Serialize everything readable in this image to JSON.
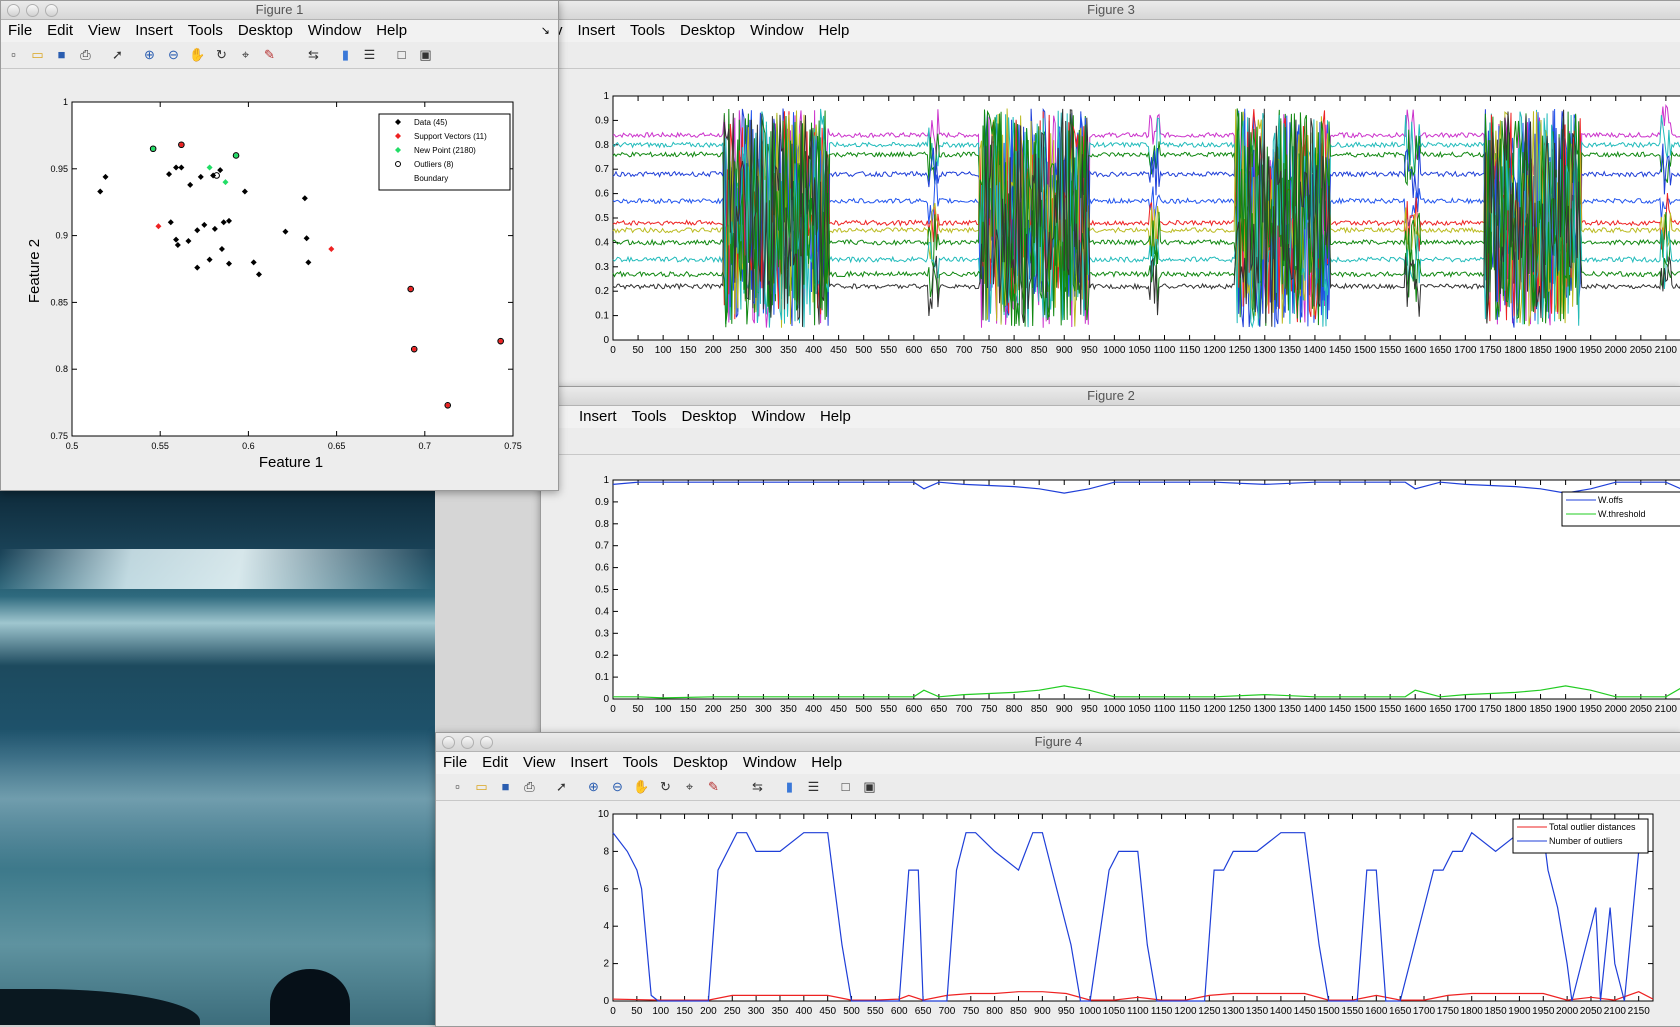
{
  "menu": [
    "File",
    "Edit",
    "View",
    "Insert",
    "Tools",
    "Desktop",
    "Window",
    "Help"
  ],
  "toolbar_icons": [
    "new-file-icon",
    "open-folder-icon",
    "save-icon",
    "print-icon",
    "pointer-icon",
    "zoom-in-icon",
    "zoom-out-icon",
    "pan-hand-icon",
    "rotate-3d-icon",
    "data-cursor-icon",
    "brush-icon",
    "link-plot-icon",
    "colorbar-icon",
    "legend-icon",
    "hide-plot-tools-icon",
    "show-plot-tools-icon"
  ],
  "figure1": {
    "title": "Figure 1",
    "chart_data": {
      "type": "scatter",
      "xlabel": "Feature 1",
      "ylabel": "Feature 2",
      "xlim": [
        0.5,
        0.75
      ],
      "ylim": [
        0.75,
        1
      ],
      "xticks": [
        "0.5",
        "0.55",
        "0.6",
        "0.65",
        "0.7",
        "0.75"
      ],
      "yticks": [
        "0.75",
        "0.8",
        "0.85",
        "0.9",
        "0.95",
        "1"
      ],
      "legend_position": "top-right",
      "legend": [
        "Data (45)",
        "Support Vectors (11)",
        "New Point (2180)",
        "Outliers (8)",
        "Boundary"
      ],
      "data_points": [
        [
          0.516,
          0.933
        ],
        [
          0.519,
          0.944
        ],
        [
          0.555,
          0.946
        ],
        [
          0.559,
          0.951
        ],
        [
          0.562,
          0.951
        ],
        [
          0.567,
          0.938
        ],
        [
          0.573,
          0.944
        ],
        [
          0.584,
          0.949
        ],
        [
          0.58,
          0.945
        ],
        [
          0.598,
          0.933
        ],
        [
          0.632,
          0.928
        ],
        [
          0.556,
          0.91
        ],
        [
          0.559,
          0.897
        ],
        [
          0.56,
          0.893
        ],
        [
          0.566,
          0.896
        ],
        [
          0.571,
          0.904
        ],
        [
          0.575,
          0.908
        ],
        [
          0.581,
          0.905
        ],
        [
          0.586,
          0.91
        ],
        [
          0.589,
          0.911
        ],
        [
          0.578,
          0.882
        ],
        [
          0.585,
          0.89
        ],
        [
          0.589,
          0.879
        ],
        [
          0.571,
          0.876
        ],
        [
          0.603,
          0.88
        ],
        [
          0.606,
          0.871
        ],
        [
          0.621,
          0.903
        ],
        [
          0.633,
          0.898
        ],
        [
          0.634,
          0.88
        ]
      ],
      "support_vectors": [
        [
          0.549,
          0.907
        ],
        [
          0.562,
          0.968
        ],
        [
          0.647,
          0.89
        ],
        [
          0.692,
          0.86
        ],
        [
          0.694,
          0.815
        ],
        [
          0.713,
          0.773
        ],
        [
          0.743,
          0.821
        ]
      ],
      "new_points": [
        [
          0.578,
          0.951
        ],
        [
          0.587,
          0.94
        ],
        [
          0.593,
          0.96
        ],
        [
          0.546,
          0.965
        ]
      ],
      "outliers": [
        [
          0.546,
          0.965
        ],
        [
          0.562,
          0.968
        ],
        [
          0.582,
          0.945
        ],
        [
          0.593,
          0.96
        ],
        [
          0.692,
          0.86
        ],
        [
          0.694,
          0.815
        ],
        [
          0.713,
          0.773
        ],
        [
          0.743,
          0.821
        ]
      ]
    }
  },
  "figure2": {
    "title": "Figure 2",
    "chart_data": {
      "type": "line",
      "xlim": [
        0,
        2180
      ],
      "ylim": [
        0,
        1
      ],
      "xticks": [
        "0",
        "50",
        "100",
        "150",
        "200",
        "250",
        "300",
        "350",
        "400",
        "450",
        "500",
        "550",
        "600",
        "650",
        "700",
        "750",
        "800",
        "850",
        "900",
        "950",
        "1000",
        "1050",
        "1100",
        "1150",
        "1200",
        "1250",
        "1300",
        "1350",
        "1400",
        "1450",
        "1500",
        "1550",
        "1600",
        "1650",
        "1700",
        "1750",
        "1800",
        "1850",
        "1900",
        "1950",
        "2000",
        "2050",
        "2100",
        "2150"
      ],
      "yticks": [
        "0",
        "0.1",
        "0.2",
        "0.3",
        "0.4",
        "0.5",
        "0.6",
        "0.7",
        "0.8",
        "0.9",
        "1"
      ],
      "legend_position": "top-right",
      "series": [
        {
          "name": "W.offs",
          "color": "#1f3fd8",
          "x": [
            0,
            50,
            100,
            200,
            300,
            400,
            550,
            600,
            620,
            650,
            700,
            800,
            850,
            900,
            950,
            1000,
            1100,
            1200,
            1300,
            1400,
            1500,
            1580,
            1600,
            1650,
            1700,
            1800,
            1850,
            1900,
            1950,
            2000,
            2100,
            2130,
            2150
          ],
          "y": [
            0.98,
            0.99,
            0.99,
            0.99,
            0.99,
            0.99,
            0.99,
            0.99,
            0.96,
            0.99,
            0.98,
            0.97,
            0.96,
            0.94,
            0.96,
            0.99,
            0.99,
            0.99,
            0.98,
            0.99,
            0.99,
            0.99,
            0.96,
            0.99,
            0.98,
            0.97,
            0.96,
            0.94,
            0.96,
            0.99,
            0.99,
            0.96,
            0.99
          ]
        },
        {
          "name": "W.threshold",
          "color": "#22cc22",
          "x": [
            0,
            50,
            100,
            200,
            300,
            400,
            550,
            600,
            620,
            650,
            700,
            800,
            850,
            900,
            950,
            1000,
            1100,
            1200,
            1300,
            1400,
            1500,
            1580,
            1600,
            1650,
            1700,
            1800,
            1850,
            1900,
            1950,
            2000,
            2100,
            2130,
            2150
          ],
          "y": [
            0.01,
            0.01,
            0.005,
            0.01,
            0.01,
            0.01,
            0.01,
            0.01,
            0.04,
            0.01,
            0.02,
            0.03,
            0.04,
            0.06,
            0.04,
            0.01,
            0.01,
            0.01,
            0.02,
            0.01,
            0.01,
            0.01,
            0.04,
            0.01,
            0.02,
            0.03,
            0.04,
            0.06,
            0.04,
            0.01,
            0.01,
            0.05,
            0.01
          ]
        }
      ]
    }
  },
  "figure3": {
    "title": "Figure 3",
    "chart_data": {
      "type": "line",
      "xlim": [
        0,
        2180
      ],
      "ylim": [
        0,
        1
      ],
      "xticks": [
        "0",
        "50",
        "100",
        "150",
        "200",
        "250",
        "300",
        "350",
        "400",
        "450",
        "500",
        "550",
        "600",
        "650",
        "700",
        "750",
        "800",
        "850",
        "900",
        "950",
        "1000",
        "1050",
        "1100",
        "1150",
        "1200",
        "1250",
        "1300",
        "1350",
        "1400",
        "1450",
        "1500",
        "1550",
        "1600",
        "1650",
        "1700",
        "1750",
        "1800",
        "1850",
        "1900",
        "1950",
        "2000",
        "2050",
        "2100",
        "2150"
      ],
      "yticks": [
        "0",
        "0.1",
        "0.2",
        "0.3",
        "0.4",
        "0.5",
        "0.6",
        "0.7",
        "0.8",
        "0.9",
        "1"
      ],
      "series": [
        {
          "color": "#cc33cc",
          "level": 0.84
        },
        {
          "color": "#22bbbb",
          "level": 0.8
        },
        {
          "color": "#118811",
          "level": 0.76
        },
        {
          "color": "#1f3fd8",
          "level": 0.68
        },
        {
          "color": "#2255ee",
          "level": 0.57
        },
        {
          "color": "#ee2222",
          "level": 0.48
        },
        {
          "color": "#bbbb22",
          "level": 0.45
        },
        {
          "color": "#118811",
          "level": 0.4
        },
        {
          "color": "#22bbbb",
          "level": 0.33
        },
        {
          "color": "#118811",
          "level": 0.27
        },
        {
          "color": "#333333",
          "level": 0.22
        }
      ]
    }
  },
  "figure4": {
    "title": "Figure 4",
    "chart_data": {
      "type": "line",
      "xlim": [
        0,
        2180
      ],
      "ylim": [
        0,
        10
      ],
      "xticks": [
        "0",
        "50",
        "100",
        "150",
        "200",
        "250",
        "300",
        "350",
        "400",
        "450",
        "500",
        "550",
        "600",
        "650",
        "700",
        "750",
        "800",
        "850",
        "900",
        "950",
        "1000",
        "1050",
        "1100",
        "1150",
        "1200",
        "1250",
        "1300",
        "1350",
        "1400",
        "1450",
        "1500",
        "1550",
        "1600",
        "1650",
        "1700",
        "1750",
        "1800",
        "1850",
        "1900",
        "1950",
        "2000",
        "2050",
        "2100",
        "2150"
      ],
      "yticks": [
        "0",
        "2",
        "4",
        "6",
        "8",
        "10"
      ],
      "legend_position": "top-right",
      "series": [
        {
          "name": "Total outlier distances",
          "color": "#ee2222",
          "x": [
            0,
            100,
            200,
            250,
            300,
            350,
            400,
            450,
            500,
            550,
            600,
            620,
            650,
            700,
            750,
            800,
            850,
            900,
            950,
            1000,
            1050,
            1100,
            1150,
            1200,
            1250,
            1300,
            1350,
            1400,
            1450,
            1500,
            1550,
            1600,
            1650,
            1700,
            1750,
            1800,
            1850,
            1900,
            1950,
            2000,
            2050,
            2100,
            2150,
            2180
          ],
          "y": [
            0.1,
            0.05,
            0.05,
            0.3,
            0.3,
            0.3,
            0.3,
            0.3,
            0.05,
            0.05,
            0.1,
            0.3,
            0.05,
            0.3,
            0.4,
            0.4,
            0.5,
            0.5,
            0.4,
            0.05,
            0.05,
            0.2,
            0.05,
            0.05,
            0.3,
            0.4,
            0.4,
            0.4,
            0.4,
            0.05,
            0.05,
            0.3,
            0.05,
            0.05,
            0.3,
            0.4,
            0.4,
            0.4,
            0.4,
            0.05,
            0.2,
            0.05,
            0.5,
            0.1
          ]
        },
        {
          "name": "Number of outliers",
          "color": "#1f3fd8",
          "x": [
            0,
            30,
            50,
            60,
            80,
            95,
            100,
            180,
            200,
            220,
            240,
            260,
            280,
            300,
            350,
            400,
            450,
            460,
            480,
            500,
            580,
            600,
            620,
            640,
            650,
            700,
            720,
            740,
            760,
            800,
            850,
            880,
            900,
            920,
            960,
            980,
            1000,
            1040,
            1060,
            1080,
            1100,
            1120,
            1140,
            1150,
            1240,
            1260,
            1280,
            1300,
            1350,
            1400,
            1450,
            1460,
            1480,
            1500,
            1560,
            1580,
            1600,
            1620,
            1640,
            1650,
            1720,
            1740,
            1760,
            1780,
            1800,
            1850,
            1900,
            1950,
            1960,
            1980,
            2000,
            2010,
            2030,
            2060,
            2070,
            2090,
            2100,
            2120,
            2150,
            2170
          ],
          "y": [
            9,
            8,
            7,
            6,
            0.3,
            0,
            0,
            0,
            0,
            7,
            8,
            9,
            9,
            9,
            8,
            9,
            9,
            7,
            3,
            0,
            0,
            0,
            7,
            8,
            0,
            0,
            8,
            9,
            9,
            9,
            8,
            9,
            9,
            7,
            3,
            0,
            0,
            7,
            8,
            9,
            8,
            3,
            0,
            0,
            0,
            7,
            8,
            9,
            8,
            9,
            9,
            7,
            3,
            0,
            0,
            7,
            8,
            0,
            0,
            0,
            7,
            8,
            9,
            8,
            9,
            8,
            9,
            9,
            8,
            5,
            2,
            0,
            2,
            5,
            0,
            5,
            2,
            0,
            8,
            9
          ]
        }
      ]
    }
  }
}
